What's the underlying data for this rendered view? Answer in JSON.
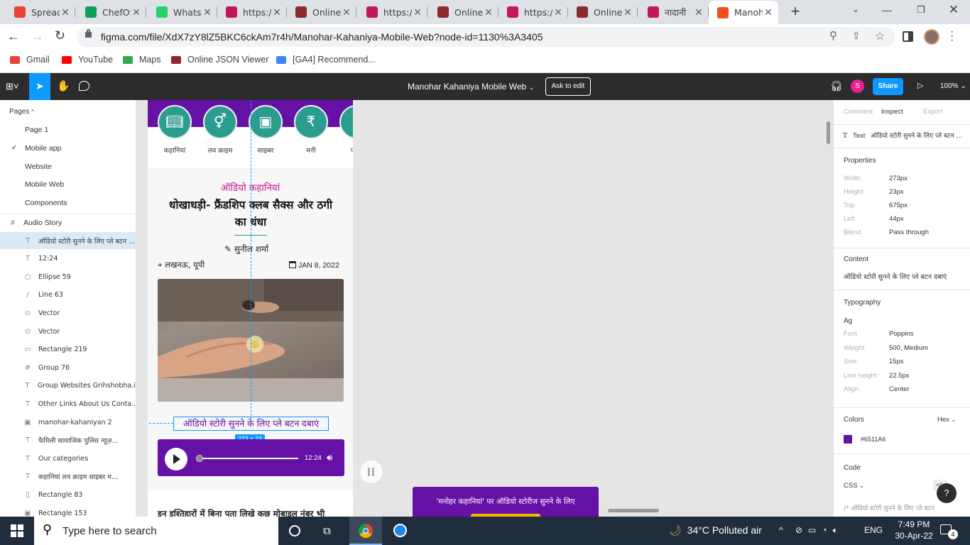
{
  "browser": {
    "tabs": [
      {
        "title": "Spreadsheet",
        "favicon": "gmail-icon",
        "color": "#ea4335"
      },
      {
        "title": "ChefOS",
        "favicon": "sheets-icon",
        "color": "#0f9d58"
      },
      {
        "title": "WhatsApp",
        "favicon": "whatsapp-icon",
        "color": "#25d366"
      },
      {
        "title": "https://",
        "favicon": "site-icon",
        "color": "#c2185b"
      },
      {
        "title": "Online",
        "favicon": "online-icon",
        "color": "#8b2a2a"
      },
      {
        "title": "https://",
        "favicon": "site-icon",
        "color": "#c2185b"
      },
      {
        "title": "Online",
        "favicon": "online-icon",
        "color": "#8b2a2a"
      },
      {
        "title": "https://",
        "favicon": "site-icon",
        "color": "#c2185b"
      },
      {
        "title": "Online",
        "favicon": "online-icon",
        "color": "#8b2a2a"
      },
      {
        "title": "नादानी",
        "favicon": "site-icon",
        "color": "#c2185b"
      },
      {
        "title": "Manoh",
        "favicon": "figma-icon",
        "color": "#f24e1e"
      }
    ],
    "new_tab": "+",
    "url": "figma.com/file/XdX7zY8lZ5BKC6ckAm7r4h/Manohar-Kahaniya-Mobile-Web?node-id=1130%3A3405",
    "bookmarks": [
      {
        "label": "Gmail",
        "icon": "gmail-icon"
      },
      {
        "label": "YouTube",
        "icon": "youtube-icon"
      },
      {
        "label": "Maps",
        "icon": "maps-icon"
      },
      {
        "label": "Online JSON Viewer",
        "icon": "json-icon"
      },
      {
        "label": "[GA4] Recommend...",
        "icon": "google-icon"
      }
    ]
  },
  "figma": {
    "file_title": "Manohar Kahaniya Mobile Web",
    "ask_to_edit": "Ask to edit",
    "avatar_letter": "S",
    "share": "Share",
    "zoom": "100%",
    "pages_header": "Pages",
    "pages": [
      "Page 1",
      "Mobile app",
      "Website",
      "Mobile Web",
      "Components"
    ],
    "current_page": "Mobile app",
    "frame": "Audio Story",
    "layers": [
      {
        "icon": "T",
        "name": "ऑडियो स्टोरी सुनने के लिए प्ले बटन ...",
        "selected": true
      },
      {
        "icon": "T",
        "name": "12:24"
      },
      {
        "icon": "○",
        "name": "Ellipse 59"
      },
      {
        "icon": "/",
        "name": "Line 63"
      },
      {
        "icon": "⊙",
        "name": "Vector"
      },
      {
        "icon": "⊙",
        "name": "Vector"
      },
      {
        "icon": "▭",
        "name": "Rectangle 219"
      },
      {
        "icon": "#",
        "name": "Group 76"
      },
      {
        "icon": "T",
        "name": "Group Websites Grihshobha.in..."
      },
      {
        "icon": "T",
        "name": "Other Links About Us Conta..."
      },
      {
        "icon": "▣",
        "name": "manohar-kahaniyan 2"
      },
      {
        "icon": "T",
        "name": "फैमिली सामाजिक पुलिस न्यूज़..."
      },
      {
        "icon": "T",
        "name": "Our categories"
      },
      {
        "icon": "T",
        "name": "कहानियां लव क्राइम साइबर म..."
      },
      {
        "icon": "▯",
        "name": "Rectangle 83"
      },
      {
        "icon": "▣",
        "name": "Rectangle 153"
      }
    ]
  },
  "design": {
    "categories": [
      {
        "label": "कहानियां",
        "icon": "book-icon"
      },
      {
        "label": "लव क्राइम",
        "icon": "gender-icon"
      },
      {
        "label": "साइबर",
        "icon": "devices-icon"
      },
      {
        "label": "मनी",
        "icon": "rupee-icon"
      },
      {
        "label": "पॉलि",
        "icon": "partial-icon"
      }
    ],
    "category_tag": "ऑडियो कहानियां",
    "headline": "धोखाधड़ी- फ्रैंडशिप क्लब सैक्स और ठगी का धंधा",
    "author": "सुनील शर्मा",
    "location": "लखनऊ, यूपी",
    "date": "JAN 8, 2022",
    "audio_prompt": "ऑडियो स्टोरी सुनने के लिए प्ले बटन दबाएं",
    "selection_size": "273 × 23",
    "audio_time": "12:24",
    "body_start": "इन इश्तिहारों में बिना पता लिखे कुछ मोबाइल नंबर भी",
    "popup_text": "'मनोहर कहानियां' पर ऑडियो स्टोरीज सुनने के लिए",
    "purple": "#6511A6",
    "teal": "#2a9d8f",
    "magenta": "#c2188f"
  },
  "inspect": {
    "tabs": [
      "Comment",
      "Inspect",
      "Export"
    ],
    "active_tab": "Inspect",
    "node_label": "Text",
    "node_name": "ऑडियो स्टोरी सुनने के लिए प्ले बटन ...",
    "properties_title": "Properties",
    "properties": [
      {
        "key": "Width",
        "value": "273px"
      },
      {
        "key": "Height",
        "value": "23px"
      },
      {
        "key": "Top",
        "value": "675px"
      },
      {
        "key": "Left",
        "value": "44px"
      },
      {
        "key": "Blend",
        "value": "Pass through"
      }
    ],
    "content_title": "Content",
    "content_text": "ऑडियो स्टोरी सुनने के लिए प्ले बटन दबाएं",
    "typography_title": "Typography",
    "typography_sample": "Ag",
    "typography": [
      {
        "key": "Font",
        "value": "Poppins"
      },
      {
        "key": "Weight",
        "value": "500, Medium"
      },
      {
        "key": "Size",
        "value": "15px"
      },
      {
        "key": "Line height",
        "value": "22.5px"
      },
      {
        "key": "Align",
        "value": "Center"
      }
    ],
    "colors_title": "Colors",
    "color_format": "Hex",
    "color_value": "#6511A6",
    "code_title": "Code",
    "code_lang": "CSS",
    "code_comment": "/* ऑडियो स्टोरी सुनने के लिए प्ले बटन",
    "help": "?"
  },
  "taskbar": {
    "search_placeholder": "Type here to search",
    "weather": "34°C  Polluted air",
    "lang": "ENG",
    "time": "7:49 PM",
    "date": "30-Apr-22",
    "notifications": "4"
  }
}
